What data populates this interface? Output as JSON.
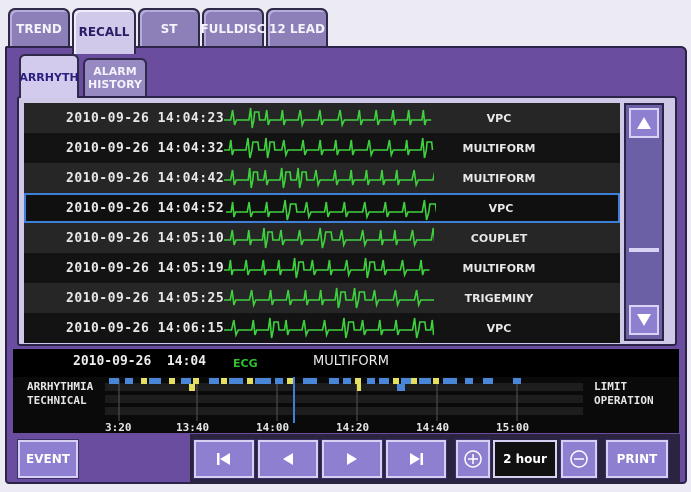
{
  "top_tabs": [
    {
      "label": "TREND",
      "active": false
    },
    {
      "label": "RECALL",
      "active": true
    },
    {
      "label": "ST",
      "active": false
    },
    {
      "label": "FULLDISC",
      "active": false
    },
    {
      "label": "12 LEAD",
      "active": false
    }
  ],
  "sub_tabs": [
    {
      "label": "ARRHYTH",
      "active": true
    },
    {
      "label": "ALARM\nHISTORY",
      "active": false
    }
  ],
  "events": [
    {
      "timestamp": "2010-09-26 14:04:23",
      "type": "VPC",
      "selected": false
    },
    {
      "timestamp": "2010-09-26 14:04:32",
      "type": "MULTIFORM",
      "selected": false
    },
    {
      "timestamp": "2010-09-26 14:04:42",
      "type": "MULTIFORM",
      "selected": false
    },
    {
      "timestamp": "2010-09-26 14:04:52",
      "type": "VPC",
      "selected": true
    },
    {
      "timestamp": "2010-09-26 14:05:10",
      "type": "COUPLET",
      "selected": false
    },
    {
      "timestamp": "2010-09-26 14:05:19",
      "type": "MULTIFORM",
      "selected": false
    },
    {
      "timestamp": "2010-09-26 14:05:25",
      "type": "TRIGEMINY",
      "selected": false
    },
    {
      "timestamp": "2010-09-26 14:06:15",
      "type": "VPC",
      "selected": false
    }
  ],
  "scroll": {
    "up_icon": "triangle-up-icon",
    "down_icon": "triangle-down-icon"
  },
  "status": {
    "date": "2010-09-26  14:04",
    "lead": "ECG",
    "annotation": "MULTIFORM"
  },
  "timeline": {
    "left_labels": [
      "ARRHYTHMIA",
      "TECHNICAL"
    ],
    "right_labels": [
      "LIMIT",
      "OPERATION"
    ],
    "ticks": [
      "3:20",
      "13:40",
      "14:00",
      "14:20",
      "14:40",
      "15:00"
    ]
  },
  "buttons": {
    "event": "EVENT",
    "first_icon": "skip-to-first-icon",
    "prev_icon": "step-back-icon",
    "next_icon": "step-forward-icon",
    "last_icon": "skip-to-last-icon",
    "zoom_in_icon": "zoom-in-icon",
    "period": "2 hour",
    "zoom_out_icon": "zoom-out-icon",
    "print": "PRINT"
  },
  "colors": {
    "accent": "#6a4d9f",
    "trace": "#3ed13e",
    "selection": "#3f7fd8",
    "arrhythmia_marker": "#4a86d8",
    "technical_marker": "#e6e060"
  }
}
